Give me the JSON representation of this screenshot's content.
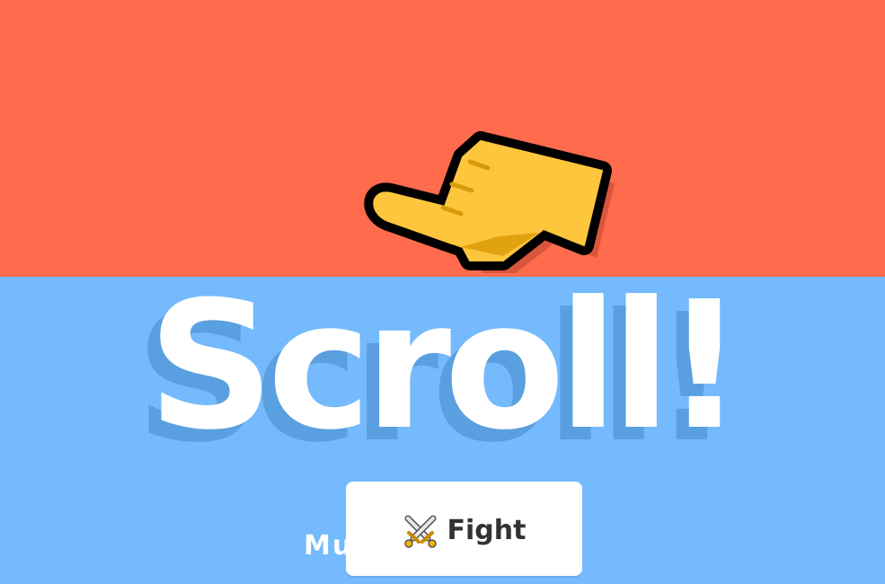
{
  "screen": {
    "title": "Scroll!",
    "subtitle": "Multiplayer Quiz",
    "top_color": "#ff6b4d",
    "bottom_color": "#74bafc"
  },
  "fight_button": {
    "icon": "crossed-swords-icon",
    "label": "Fight"
  },
  "pointer": {
    "icon": "pointing-hand-icon"
  }
}
